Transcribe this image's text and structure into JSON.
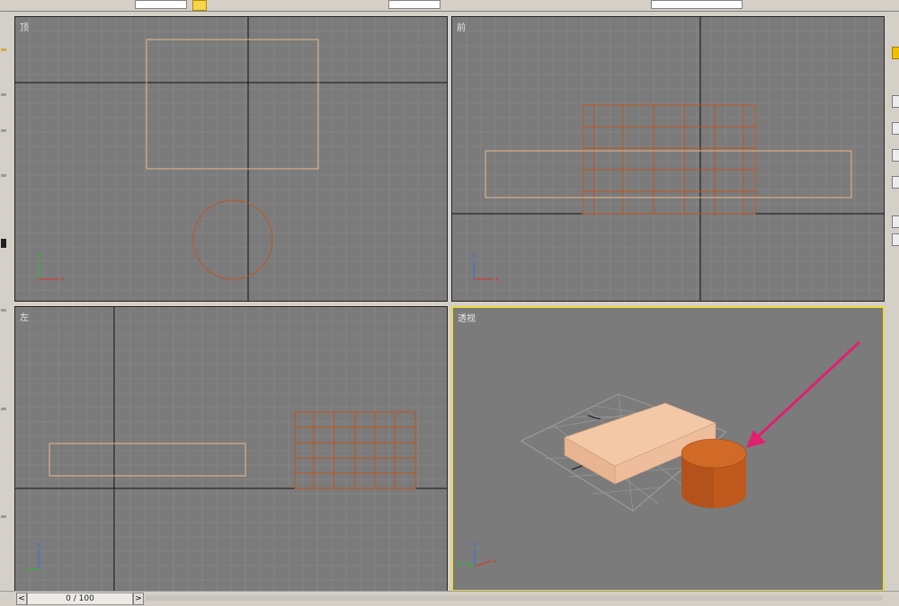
{
  "viewports": {
    "top": {
      "label": "顶",
      "active": false
    },
    "front": {
      "label": "前",
      "active": false
    },
    "left": {
      "label": "左",
      "active": false
    },
    "perspective": {
      "label": "透视",
      "active": true
    }
  },
  "axis_labels": {
    "x": "x",
    "y": "y",
    "z": "z"
  },
  "timeline": {
    "counter": "0 / 100",
    "prev": "<",
    "next": ">"
  },
  "colors": {
    "viewport_bg": "#7b7b7b",
    "grid": "#8c8c8c",
    "box_wire": "#e8b888",
    "cylinder_wire": "#c0541c",
    "box_face": "#f2c8a6",
    "cylinder_face": "#c85e1c",
    "active_border": "#ecd93a",
    "arrow": "#e02070"
  }
}
